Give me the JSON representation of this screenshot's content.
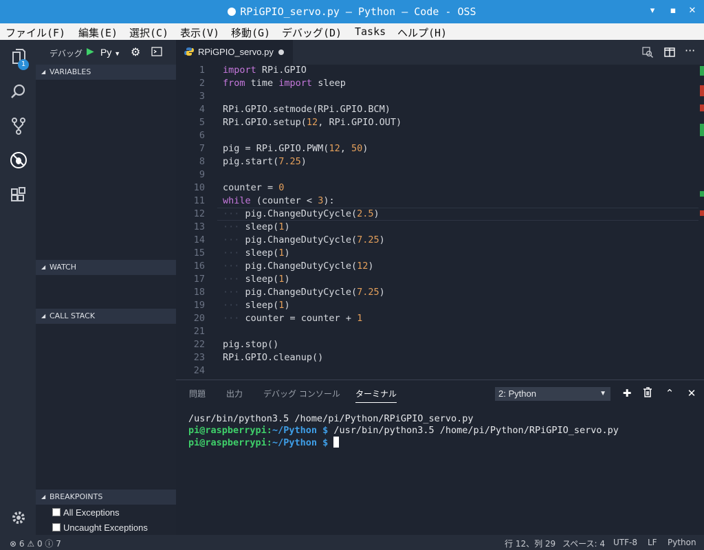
{
  "window": {
    "title": "RPiGPIO_servo.py — Python — Code - OSS"
  },
  "menu": [
    "ファイル(F)",
    "編集(E)",
    "選択(C)",
    "表示(V)",
    "移動(G)",
    "デバッグ(D)",
    "Tasks",
    "ヘルプ(H)"
  ],
  "activity": {
    "badge": "1"
  },
  "debug": {
    "label": "デバッグ",
    "config": "Py",
    "sections": {
      "variables": "VARIABLES",
      "watch": "WATCH",
      "callstack": "CALL STACK",
      "breakpoints": "BREAKPOINTS"
    },
    "breakpoints": [
      {
        "label": "All Exceptions",
        "checked": false
      },
      {
        "label": "Uncaught Exceptions",
        "checked": false
      }
    ]
  },
  "editor": {
    "tab": "RPiGPIO_servo.py",
    "lines": [
      "import RPi.GPIO",
      "from time import sleep",
      "",
      "RPi.GPIO.setmode(RPi.GPIO.BCM)",
      "RPi.GPIO.setup(12, RPi.GPIO.OUT)",
      "",
      "pig = RPi.GPIO.PWM(12, 50)",
      "pig.start(7.25)",
      "",
      "counter = 0",
      "while (counter < 3):",
      "    pig.ChangeDutyCycle(2.5)",
      "    sleep(1)",
      "    pig.ChangeDutyCycle(7.25)",
      "    sleep(1)",
      "    pig.ChangeDutyCycle(12)",
      "    sleep(1)",
      "    pig.ChangeDutyCycle(7.25)",
      "    sleep(1)",
      "    counter = counter + 1",
      "",
      "pig.stop()",
      "RPi.GPIO.cleanup()",
      ""
    ]
  },
  "panel": {
    "tabs": [
      "問題",
      "出力",
      "デバッグ コンソール",
      "ターミナル"
    ],
    "active_tab": "ターミナル",
    "terminal_select": "2: Python",
    "terminal": {
      "line1": "/usr/bin/python3.5 /home/pi/Python/RPiGPIO_servo.py",
      "user": "pi@raspberrypi",
      "colon": ":",
      "path": "~/Python $",
      "cmd": " /usr/bin/python3.5 /home/pi/Python/RPiGPIO_servo.py"
    }
  },
  "status": {
    "errors": "6",
    "warnings": "0",
    "infos": "7",
    "position": "行 12、列 29",
    "spaces": "スペース: 4",
    "encoding": "UTF-8",
    "eol": "LF",
    "language": "Python"
  },
  "colors": {
    "accent": "#2a8fd8",
    "background": "#1e2430",
    "sidebar": "#1f2531",
    "keyword": "#c678dd",
    "number": "#e5a05b"
  }
}
